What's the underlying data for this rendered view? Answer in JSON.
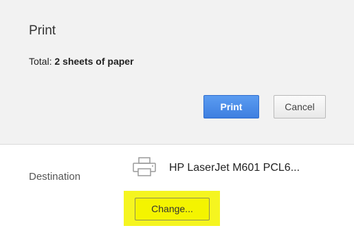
{
  "dialog": {
    "title": "Print",
    "total_prefix": "Total: ",
    "total_value": "2 sheets of paper",
    "print_label": "Print",
    "cancel_label": "Cancel"
  },
  "destination": {
    "label": "Destination",
    "printer_name": "HP LaserJet M601 PCL6...",
    "change_label": "Change...",
    "printer_icon": "printer-icon"
  },
  "colors": {
    "header_bg": "#f2f2f2",
    "print_button": "#4a8af4",
    "highlight": "#f5f520"
  }
}
